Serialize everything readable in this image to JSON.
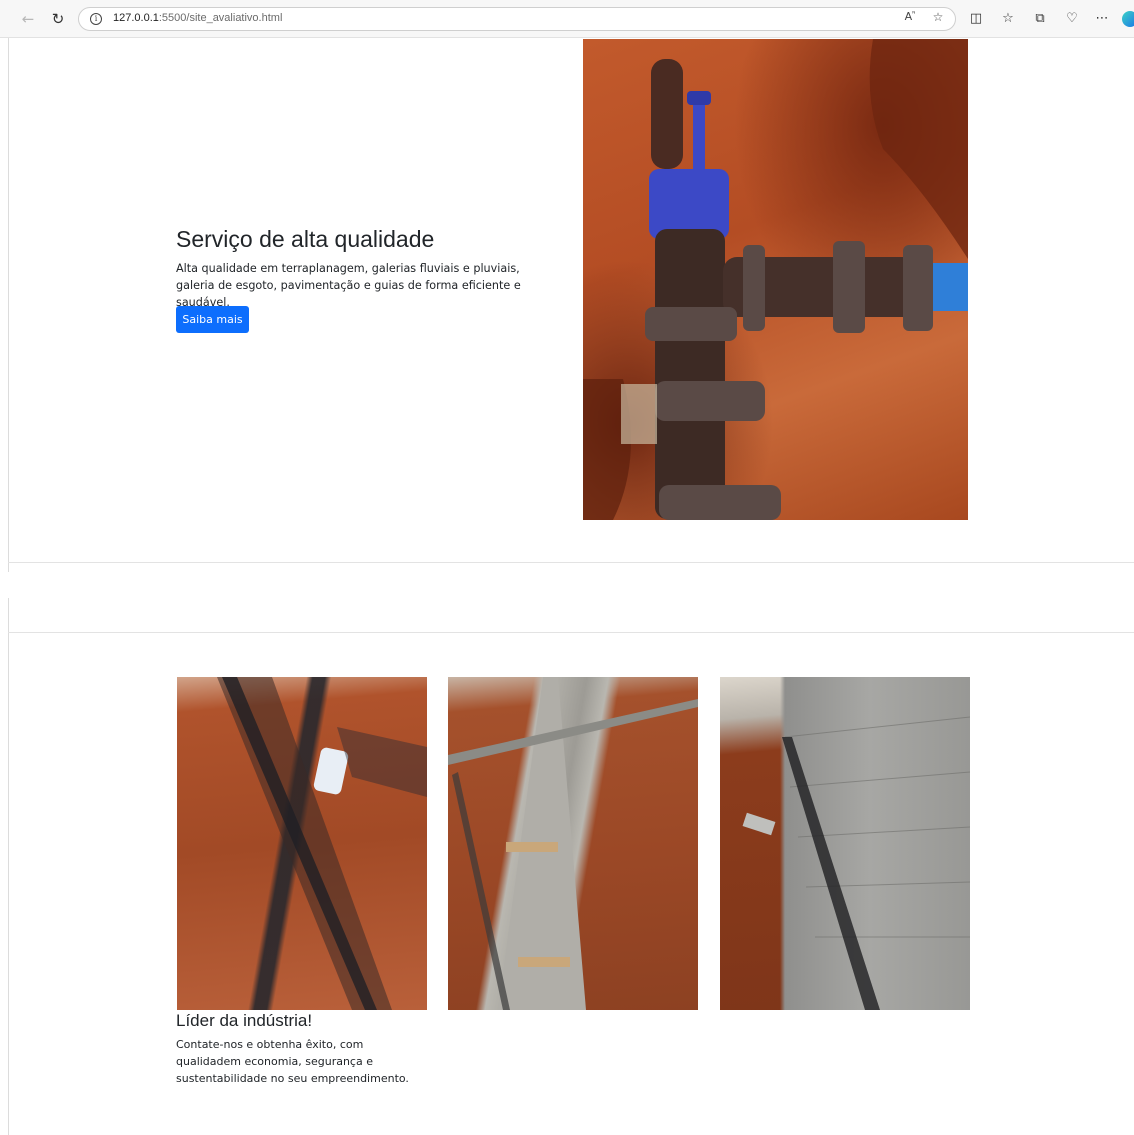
{
  "browser": {
    "url_host": "127.0.0.1",
    "url_path": ":5500/site_avaliativo.html",
    "info_icon_glyph": "i",
    "read_aloud_glyph": "A",
    "read_aloud_sup": "ᴺ"
  },
  "icons": {
    "back": "back-arrow-icon",
    "refresh": "refresh-icon",
    "info": "info-icon",
    "read_aloud": "read-aloud-icon",
    "favorite": "star-icon",
    "split_screen": "split-screen-icon",
    "favorites_list": "favorites-icon",
    "collections": "collections-icon",
    "browser_essentials": "heart-pulse-icon",
    "more": "more-icon",
    "profile": "edge-logo-icon"
  },
  "hero": {
    "title": "Serviço de alta qualidade",
    "text": "Alta qualidade em terraplanagem, galerias fluviais e pluviais, galeria de esgoto, pavimentação e guias de forma eficiente e saudável.",
    "button_label": "Saiba mais"
  },
  "card": {
    "title": "Líder da indústria!",
    "text": "Contate-nos e obtenha êxito, com qualidadem economia, segurança e sustentabilidade no seu empreendimento."
  },
  "colors": {
    "primary": "#0d6efd",
    "text": "#212529",
    "soil": "#b44d24"
  }
}
